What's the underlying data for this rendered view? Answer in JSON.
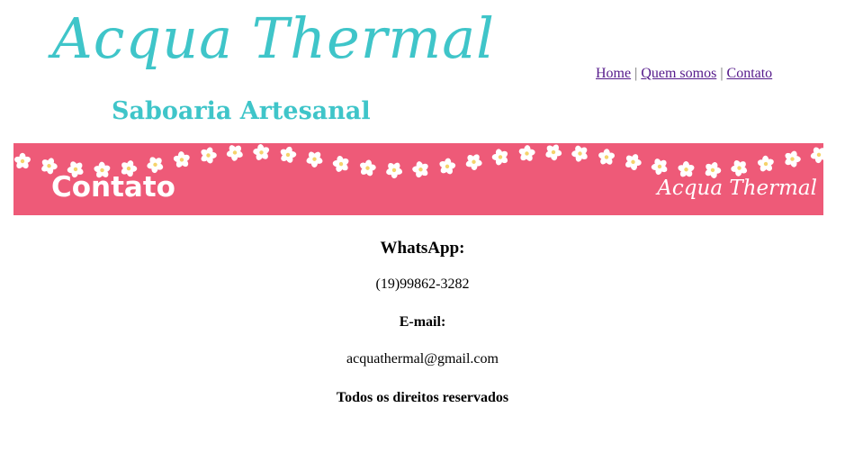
{
  "header": {
    "logo_title": "Acqua Thermal",
    "logo_subtitle": "Saboaria Artesanal"
  },
  "nav": {
    "items": [
      {
        "label": "Home"
      },
      {
        "label": "Quem somos"
      },
      {
        "label": "Contato"
      }
    ],
    "separator": "|"
  },
  "banner": {
    "title": "Contato",
    "brand": "Acqua Thermal",
    "background_color": "#ee5a78",
    "decoration": "white-flower-icons"
  },
  "contact": {
    "whatsapp_label": "WhatsApp:",
    "whatsapp_value": "(19)99862-3282",
    "email_label": "E-mail:",
    "email_value": "acquathermal@gmail.com",
    "footer": "Todos os direitos reservados"
  },
  "colors": {
    "brand_teal": "#3fc5c9",
    "link_visited": "#551a8b"
  }
}
